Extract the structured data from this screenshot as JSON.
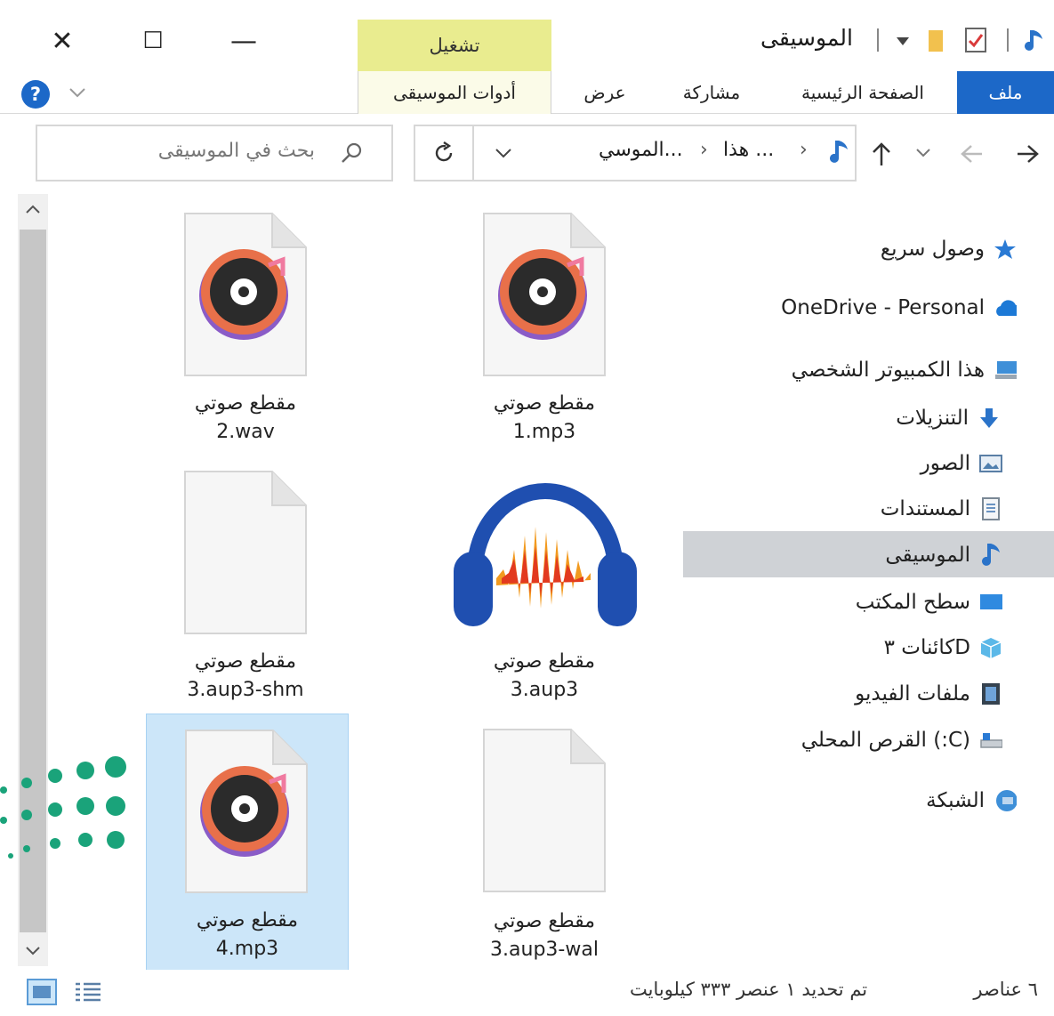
{
  "window": {
    "title": "الموسيقى",
    "play_tab": "تشغيل",
    "controls": {
      "close": "✕",
      "maximize": "☐",
      "minimize": "—"
    }
  },
  "ribbon": {
    "tabs": [
      "ملف",
      "الصفحة الرئيسية",
      "مشاركة",
      "عرض"
    ],
    "tools_tab": "أدوات الموسيقى",
    "help": "?"
  },
  "address": {
    "crumbs": [
      "هذا ...",
      "الموسي..."
    ]
  },
  "search": {
    "placeholder": "بحث في الموسيقى"
  },
  "nav": {
    "items": [
      {
        "label": "وصول سريع",
        "icon": "star-icon"
      },
      {
        "label": "OneDrive - Personal",
        "icon": "cloud-icon"
      },
      {
        "label": "هذا الكمبيوتر الشخصي",
        "icon": "computer-icon"
      },
      {
        "label": "التنزيلات",
        "icon": "download-icon"
      },
      {
        "label": "الصور",
        "icon": "pictures-icon"
      },
      {
        "label": "المستندات",
        "icon": "documents-icon"
      },
      {
        "label": "الموسيقى",
        "icon": "music-note-icon",
        "selected": true
      },
      {
        "label": "سطح المكتب",
        "icon": "desktop-icon"
      },
      {
        "label": "كائنات ٣D",
        "icon": "3d-objects-icon"
      },
      {
        "label": "ملفات الفيديو",
        "icon": "video-icon"
      },
      {
        "label": "القرص المحلي (:C)",
        "icon": "drive-icon"
      },
      {
        "label": "الشبكة",
        "icon": "network-icon"
      }
    ]
  },
  "files": [
    {
      "name": "مقطع صوتي",
      "ext": "1.mp3",
      "icon": "vinyl-file-icon"
    },
    {
      "name": "مقطع صوتي",
      "ext": "2.wav",
      "icon": "vinyl-file-icon"
    },
    {
      "name": "مقطع صوتي",
      "ext": "3.aup3",
      "icon": "audacity-icon"
    },
    {
      "name": "مقطع صوتي",
      "ext": "3.aup3-shm",
      "icon": "blank-file-icon"
    },
    {
      "name": "مقطع صوتي",
      "ext": "3.aup3-wal",
      "icon": "blank-file-icon"
    },
    {
      "name": "مقطع صوتي",
      "ext": "4.mp3",
      "icon": "vinyl-file-icon",
      "selected": true
    }
  ],
  "status": {
    "count": "٦ عناصر",
    "selection": "تم تحديد ١ عنصر  ٣٣٣ كيلوبايت"
  },
  "colors": {
    "accent": "#1c68c8",
    "play_tab": "#e9ec8f",
    "selection": "#cce6f9",
    "nav_selected": "#cfd2d6",
    "vinyl_ring": "#e8704a",
    "dots": "#1aa37a"
  }
}
